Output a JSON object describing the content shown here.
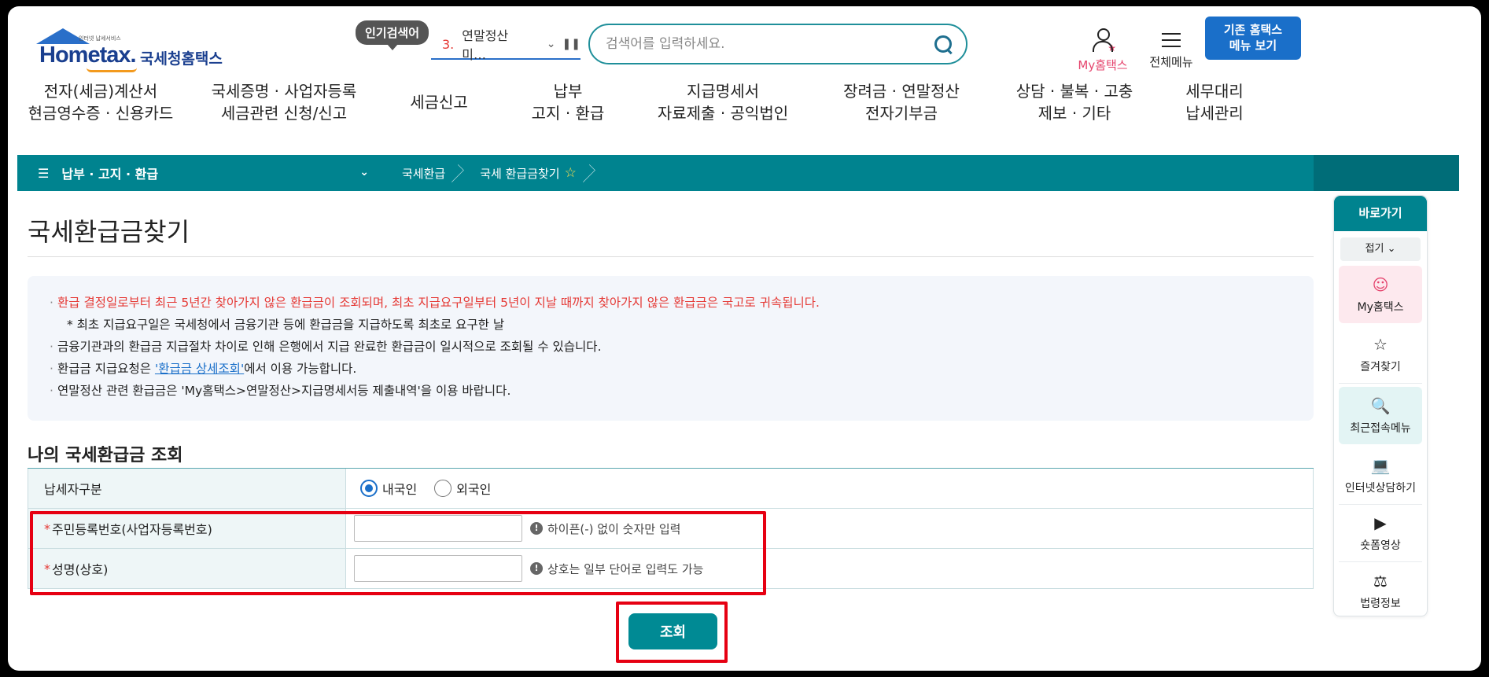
{
  "header": {
    "logo_small": "인터넷 납세서비스",
    "logo_main": "Hometax.",
    "logo_kor": "국세청홈택스",
    "popular_badge": "인기검색어",
    "popular_num": "3.",
    "popular_text": "연말정산 미…",
    "search_placeholder": "검색어를 입력하세요.",
    "my_hometax": "My홈택스",
    "all_menu": "전체메뉴",
    "old_hometax_line1": "기존 홈택스",
    "old_hometax_line2": "메뉴 보기"
  },
  "gnb": [
    {
      "l1": "전자(세금)계산서",
      "l2": "현금영수증 · 신용카드"
    },
    {
      "l1": "국세증명 · 사업자등록",
      "l2": "세금관련 신청/신고"
    },
    {
      "l1": "세금신고",
      "l2": ""
    },
    {
      "l1": "납부",
      "l2": "고지 · 환급"
    },
    {
      "l1": "지급명세서",
      "l2": "자료제출 · 공익법인"
    },
    {
      "l1": "장려금 · 연말정산",
      "l2": "전자기부금"
    },
    {
      "l1": "상담 · 불복 · 고충",
      "l2": "제보 · 기타"
    },
    {
      "l1": "세무대리",
      "l2": "납세관리"
    }
  ],
  "breadcrumb": {
    "menu": "납부 · 고지 · 환급",
    "item1": "국세환급",
    "item2": "국세 환급금찾기"
  },
  "page": {
    "title": "국세환급금찾기",
    "notices": {
      "n1": "환급 결정일로부터 최근 5년간 찾아가지 않은 환급금이 조회되며, 최초 지급요구일부터 5년이 지날 때까지 찾아가지 않은 환급금은 국고로 귀속됩니다.",
      "n2": "* 최초 지급요구일은 국세청에서 금융기관 등에 환급금을 지급하도록 최초로 요구한 날",
      "n3": "금융기관과의 환급금 지급절차 차이로 인해 은행에서 지급 완료한 환급금이 일시적으로 조회될 수 있습니다.",
      "n4_pre": "환급금 지급요청은 ",
      "n4_link": "'환급금 상세조회'",
      "n4_post": "에서 이용 가능합니다.",
      "n5": "연말정산 관련 환급금은 'My홈택스>연말정산>지급명세서등 제출내역'을 이용 바랍니다."
    },
    "section_title": "나의 국세환급금 조회",
    "form": {
      "taxpayer_type_label": "납세자구분",
      "domestic": "내국인",
      "foreign": "외국인",
      "rrn_label": "주민등록번호(사업자등록번호)",
      "rrn_hint": "하이픈(-) 없이 숫자만 입력",
      "name_label": "성명(상호)",
      "name_hint": "상호는 일부 단어로 입력도 가능",
      "required_mark": "*",
      "rrn_value": "",
      "name_value": ""
    },
    "search_button": "조회"
  },
  "quick_menu": {
    "title": "바로가기",
    "fold": "접기",
    "items": [
      {
        "label": "My홈택스",
        "icon": "person-icon"
      },
      {
        "label": "즐겨찾기",
        "icon": "star-icon"
      },
      {
        "label": "최근접속메뉴",
        "icon": "recent-menu-icon"
      },
      {
        "label": "인터넷상담하기",
        "icon": "laptop-chat-icon"
      },
      {
        "label": "숏폼영상",
        "icon": "video-play-icon"
      },
      {
        "label": "법령정보",
        "icon": "gavel-icon"
      }
    ]
  }
}
